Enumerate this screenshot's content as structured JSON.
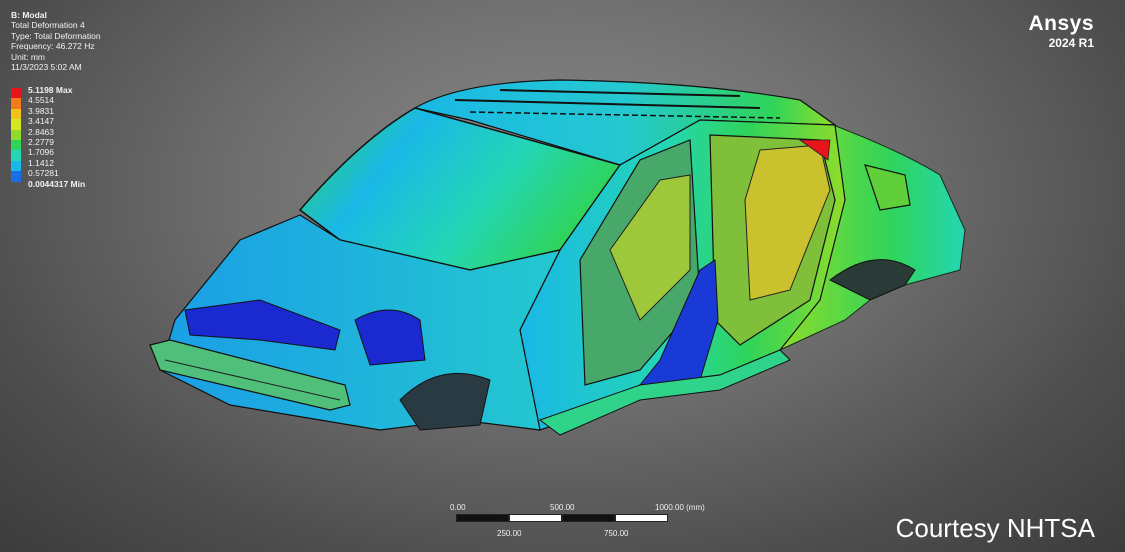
{
  "info": {
    "title": "B: Modal",
    "line1": "Total Deformation 4",
    "line2": "Type: Total Deformation",
    "line3": "Frequency: 46.272 Hz",
    "line4": "Unit: mm",
    "line5": "11/3/2023 5:02 AM"
  },
  "legend": [
    {
      "label": "5.1198 Max",
      "color": "#e8141c",
      "bold": true
    },
    {
      "label": "4.5514",
      "color": "#f27a1a",
      "bold": false
    },
    {
      "label": "3.9831",
      "color": "#f0c21a",
      "bold": false
    },
    {
      "label": "3.4147",
      "color": "#d6e81e",
      "bold": false
    },
    {
      "label": "2.8463",
      "color": "#8fdc2a",
      "bold": false
    },
    {
      "label": "2.2779",
      "color": "#2fd45a",
      "bold": false
    },
    {
      "label": "1.7096",
      "color": "#24d6b4",
      "bold": false
    },
    {
      "label": "1.1412",
      "color": "#1ab8e6",
      "bold": false
    },
    {
      "label": "0.57281",
      "color": "#1a6ee8",
      "bold": false
    },
    {
      "label": "0.0044317 Min",
      "color": "#1414d8",
      "bold": true
    }
  ],
  "brand": {
    "name": "Ansys",
    "version": "2024 R1"
  },
  "scale": {
    "top_labels": [
      "0.00",
      "500.00",
      "1000.00 (mm)"
    ],
    "bottom_labels": [
      "250.00",
      "750.00"
    ]
  },
  "courtesy": "Courtesy NHTSA"
}
